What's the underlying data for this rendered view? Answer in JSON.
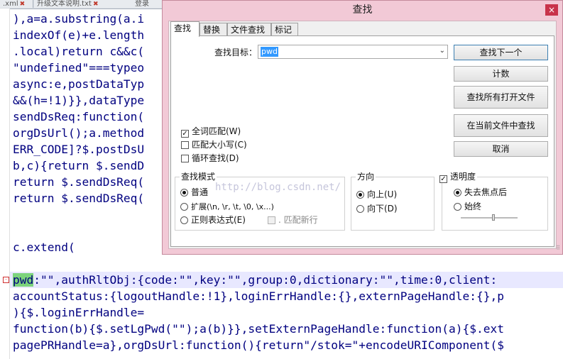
{
  "tabs": [
    {
      "label": ".xml"
    },
    {
      "label": "升级文本说明.txt"
    },
    {
      "label": "登录"
    }
  ],
  "code": {
    "top": [
      "),a=a.substring(a.i",
      "indexOf(e)+e.length",
      ".local)return c&&c(",
      "\"undefined\"===typeo",
      "async:e,postDataTyp",
      "&&(h=!1)}},dataType",
      "sendDsReq:function(",
      "orgDsUrl();a.method",
      "ERR_CODE]?$.postDsU",
      "b,c){return $.sendD",
      "return $.sendDsReq(",
      "return $.sendDsReq("
    ],
    "extend": "c.extend(",
    "bottom": [
      "accountStatus:{logoutHandle:!1},loginErrHandle:{},externPageHandle:{},p",
      "){$.loginErrHandle=",
      "function(b){$.setLgPwd(\"\");a(b)}},setExternPageHandle:function(a){$.ext",
      "pagePRHandle=a},orgDsUrl:function(){return\"/stok=\"+encodeURIComponent($"
    ],
    "hl_pwd": "pwd",
    "hl_rest": ":\"\",authRltObj:{code:\"\",key:\"\",group:0,dictionary:\"\",time:0,client:"
  },
  "dialog": {
    "title": "查找",
    "close": "×",
    "tabs": [
      "查找",
      "替换",
      "文件查找",
      "标记"
    ],
    "find_label": "查找目标：",
    "find_value": "pwd",
    "buttons": {
      "find_next": "查找下一个",
      "count": "计数",
      "find_all_open": "查找所有打开文件",
      "find_in_current": "在当前文件中查找",
      "cancel": "取消"
    },
    "checkboxes": {
      "whole_word": "全词匹配(W)",
      "match_case": "匹配大小写(C)",
      "wrap": "循环查找(D)"
    },
    "search_mode": {
      "title": "查找模式",
      "normal": "普通",
      "extended": "扩展(\\n, \\r, \\t, \\0, \\x...)",
      "regex": "正则表达式(E)",
      "dot_newline": ". 匹配新行"
    },
    "direction": {
      "title": "方向",
      "up": "向上(U)",
      "down": "向下(D)"
    },
    "transparency": {
      "title": "透明度",
      "on_lose_focus": "失去焦点后",
      "always": "始终"
    }
  },
  "watermark": "http://blog.csdn.net/",
  "colors": {
    "dialog_frame": "#f2c9d6",
    "close_button": "#c8334b",
    "selection": "#3399ff",
    "match_highlight": "#7cd37c"
  }
}
